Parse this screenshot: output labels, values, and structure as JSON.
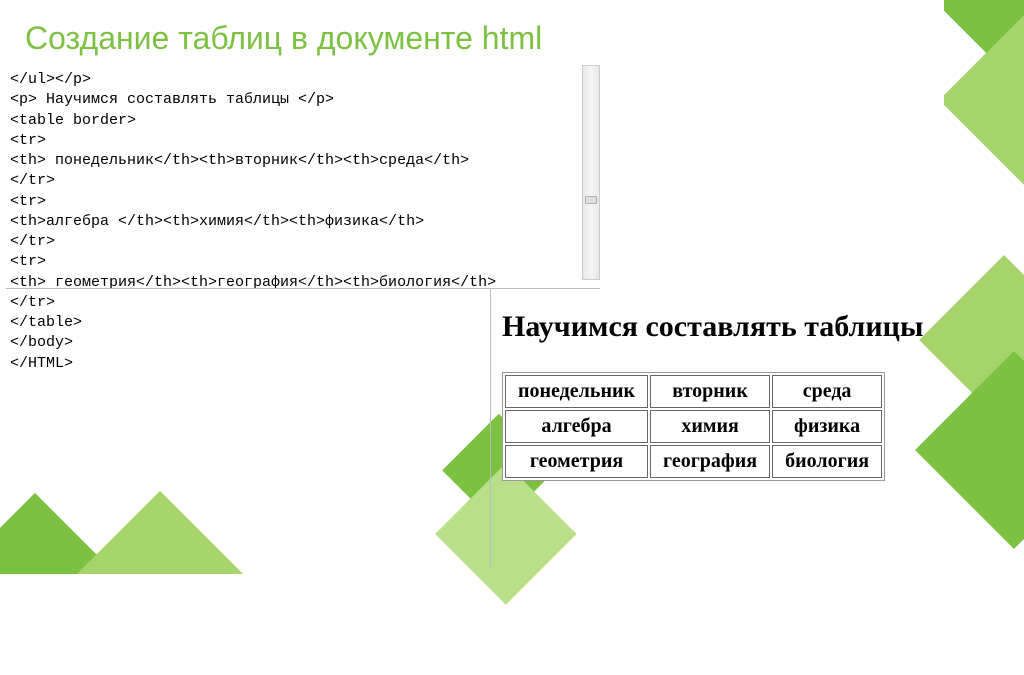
{
  "title": "Создание таблиц в документе  html",
  "code": {
    "l1": "</ul></p>",
    "l2": "<p> Научимся составлять таблицы </p>",
    "l3": "<table border>",
    "l4": "<tr>",
    "l5": "<th> понедельник</th><th>вторник</th><th>среда</th>",
    "l6": "</tr>",
    "l7": "<tr>",
    "l8": "<th>алгебра </th><th>химия</th><th>физика</th>",
    "l9": "</tr>",
    "l10": "<tr>",
    "l11": "<th> геометрия</th><th>география</th><th>биология</th>",
    "l12": "</tr>",
    "l13": "</table>",
    "l14": "</body>",
    "l15": "</HTML>"
  },
  "render": {
    "heading": "Научимся составлять таблицы",
    "row1": {
      "c1": "понедельник",
      "c2": "вторник",
      "c3": "среда"
    },
    "row2": {
      "c1": "алгебра",
      "c2": "химия",
      "c3": "физика"
    },
    "row3": {
      "c1": "геометрия",
      "c2": "география",
      "c3": "биология"
    }
  }
}
